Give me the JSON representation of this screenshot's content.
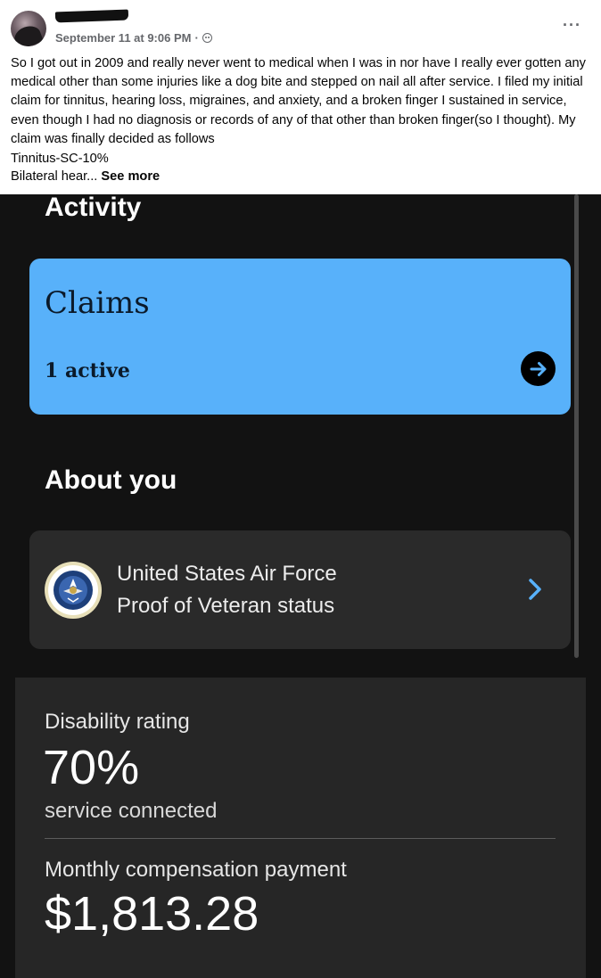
{
  "post": {
    "date": "September 11 at 9:06 PM",
    "separator": "·",
    "body": "So I got out in 2009 and really never went to medical when I was in nor have I really ever gotten any medical other than some injuries  like a dog bite and stepped on nail all after service. I filed my initial claim for tinnitus, hearing loss, migraines, and anxiety, and a broken finger I sustained in service, even though I had no diagnosis or records of any of that other than broken finger(so I thought). My claim was finally decided as follows",
    "line2": "Tinnitus-SC-10%",
    "line3_start": "Bilateral hear...",
    "see_more": "See more",
    "more_icon": "···",
    "icons": [
      "avatar",
      "globe-icon",
      "more-icon"
    ]
  },
  "app": {
    "activity_heading": "Activity",
    "claims": {
      "title": "Claims",
      "status": "1 active",
      "accent": "#58b1fa"
    },
    "about_heading": "About you",
    "veteran": {
      "branch": "United States Air Force",
      "status": "Proof of Veteran status",
      "icon": "air-force-seal-icon",
      "chevron_color": "#58b1fa"
    },
    "disability": {
      "label": "Disability rating",
      "value": "70%",
      "subtext": "service connected"
    },
    "compensation": {
      "label": "Monthly compensation payment",
      "value": "$1,813.28"
    }
  }
}
